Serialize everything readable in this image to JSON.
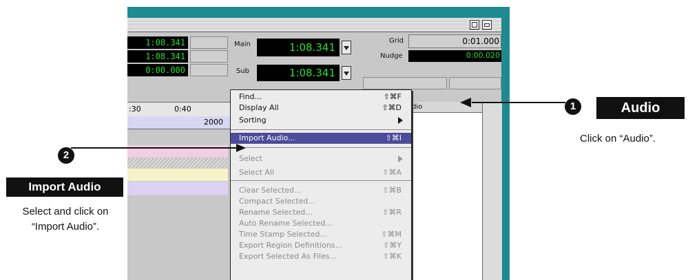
{
  "window": {
    "clocks_left": [
      "1:08.341",
      "1:08.341",
      "0:00.000"
    ],
    "main_label": "Main",
    "main_clock": "1:08.341",
    "sub_label": "Sub",
    "sub_clock": "1:08.341",
    "grid_label": "Grid",
    "grid_value": "0:01.000",
    "nudge_label": "Nudge",
    "nudge_value": "0:00.020",
    "ruler_marks": [
      ":30",
      "0:40"
    ],
    "ruler_value": "2000",
    "region_list_header": "dio"
  },
  "menu": {
    "items": [
      {
        "label": "Find...",
        "shortcut": "⇧⌘F",
        "state": "enabled"
      },
      {
        "label": "Display All",
        "shortcut": "⇧⌘D",
        "state": "enabled"
      },
      {
        "label": "Sorting",
        "shortcut": "",
        "state": "enabled",
        "submenu": true
      },
      {
        "label": "Import Audio...",
        "shortcut": "⇧⌘I",
        "state": "highlighted"
      },
      {
        "label": "Select",
        "shortcut": "",
        "state": "disabled",
        "submenu": true
      },
      {
        "label": "Select All",
        "shortcut": "⇧⌘A",
        "state": "disabled"
      },
      {
        "label": "Clear Selected...",
        "shortcut": "⇧⌘B",
        "state": "disabled"
      },
      {
        "label": "Compact Selected...",
        "shortcut": "",
        "state": "disabled"
      },
      {
        "label": "Rename Selected...",
        "shortcut": "⇧⌘R",
        "state": "disabled"
      },
      {
        "label": "Auto Rename Selected...",
        "shortcut": "",
        "state": "disabled"
      },
      {
        "label": "Time Stamp Selected...",
        "shortcut": "⇧⌘M",
        "state": "disabled"
      },
      {
        "label": "Export Region Definitions...",
        "shortcut": "⇧⌘Y",
        "state": "disabled"
      },
      {
        "label": "Export Selected As Files...",
        "shortcut": "⇧⌘K",
        "state": "disabled"
      }
    ]
  },
  "callouts": {
    "step1": {
      "number": "1",
      "title": "Audio",
      "note": "Click on “Audio”."
    },
    "step2": {
      "number": "2",
      "title": "Import Audio",
      "note_line1": "Select and click on",
      "note_line2": "“Import Audio”."
    }
  }
}
